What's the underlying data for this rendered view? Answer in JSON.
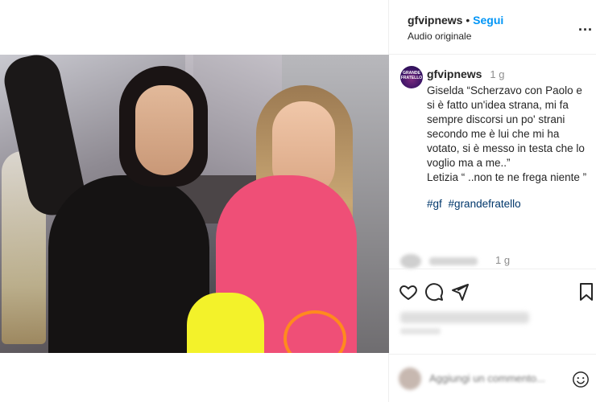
{
  "header": {
    "username": "gfvipnews",
    "separator": "•",
    "follow_label": "Segui",
    "audio_label": "Audio originale",
    "more_label": "..."
  },
  "caption": {
    "avatar_text": "GRANDE FRATELLO",
    "username": "gfvipnews",
    "time": "1 g",
    "text": "Giselda “Scherzavo con Paolo e si è fatto un'idea strana, mi fa sempre discorsi un po' strani secondo me è lui che mi ha votato, si è messo in testa che lo voglio ma a me..”\nLetizia “ ..non te ne frega niente ”",
    "tags": [
      "#gf",
      "#grandefratello"
    ]
  },
  "comment": {
    "time": "1 g"
  },
  "add_comment": {
    "placeholder": "Aggiungi un commento..."
  },
  "icons": {
    "like": "heart-icon",
    "comment": "comment-icon",
    "share": "send-icon",
    "save": "bookmark-icon",
    "emoji": "emoji-icon",
    "mute": "speaker-icon"
  },
  "colors": {
    "follow": "#0095f6",
    "hashtag": "#00376b",
    "muted_text": "#8e8e8e"
  }
}
